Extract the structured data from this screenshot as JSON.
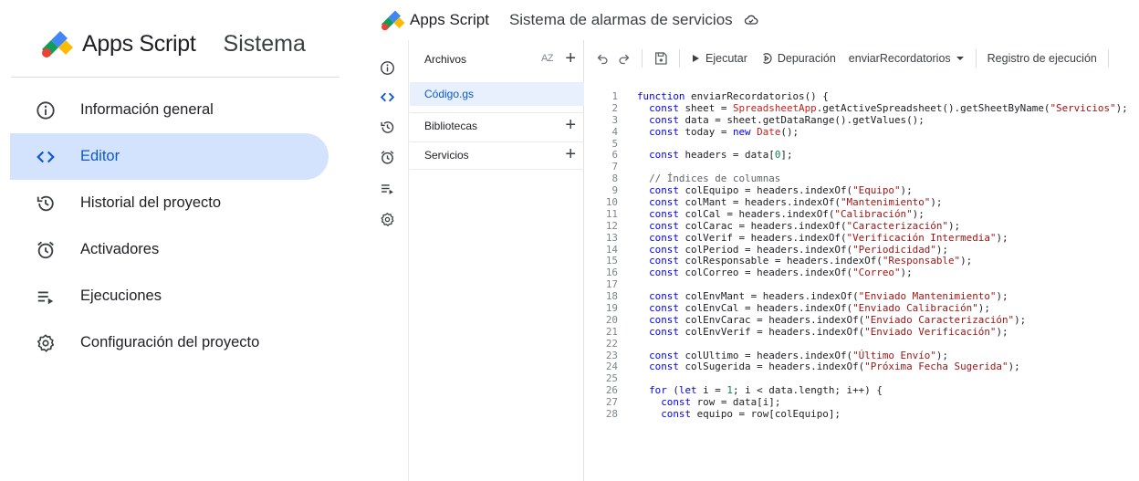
{
  "app": {
    "brand": "Apps Script",
    "project_title": "Sistema de alarmas de servicios",
    "project_title_short": "Sistema"
  },
  "left_nav": {
    "items": [
      {
        "label": "Información general",
        "icon": "info-icon"
      },
      {
        "label": "Editor",
        "icon": "code-icon",
        "active": true
      },
      {
        "label": "Historial del proyecto",
        "icon": "history-icon"
      },
      {
        "label": "Activadores",
        "icon": "alarm-icon"
      },
      {
        "label": "Ejecuciones",
        "icon": "list-run-icon"
      },
      {
        "label": "Configuración del proyecto",
        "icon": "gear-icon"
      }
    ]
  },
  "files_panel": {
    "files_label": "Archivos",
    "sort_label": "AZ",
    "active_file": "Código.gs",
    "libraries_label": "Bibliotecas",
    "services_label": "Servicios"
  },
  "toolbar": {
    "run_label": "Ejecutar",
    "debug_label": "Depuración",
    "function_selected": "enviarRecordatorios",
    "log_label": "Registro de ejecución"
  },
  "colors": {
    "accent": "#0b57d0",
    "active_bg": "#d3e3fd",
    "keyword": "#0000ff",
    "string": "#a31515"
  },
  "code_lines": [
    "function enviarRecordatorios() {",
    "  const sheet = SpreadsheetApp.getActiveSpreadsheet().getSheetByName(\"Servicios\");",
    "  const data = sheet.getDataRange().getValues();",
    "  const today = new Date();",
    "",
    "  const headers = data[0];",
    "",
    "  // Índices de columnas",
    "  const colEquipo = headers.indexOf(\"Equipo\");",
    "  const colMant = headers.indexOf(\"Mantenimiento\");",
    "  const colCal = headers.indexOf(\"Calibración\");",
    "  const colCarac = headers.indexOf(\"Caracterización\");",
    "  const colVerif = headers.indexOf(\"Verificación Intermedia\");",
    "  const colPeriod = headers.indexOf(\"Periodicidad\");",
    "  const colResponsable = headers.indexOf(\"Responsable\");",
    "  const colCorreo = headers.indexOf(\"Correo\");",
    "",
    "  const colEnvMant = headers.indexOf(\"Enviado Mantenimiento\");",
    "  const colEnvCal = headers.indexOf(\"Enviado Calibración\");",
    "  const colEnvCarac = headers.indexOf(\"Enviado Caracterización\");",
    "  const colEnvVerif = headers.indexOf(\"Enviado Verificación\");",
    "",
    "  const colUltimo = headers.indexOf(\"Último Envío\");",
    "  const colSugerida = headers.indexOf(\"Próxima Fecha Sugerida\");",
    "",
    "  for (let i = 1; i < data.length; i++) {",
    "    const row = data[i];",
    "    const equipo = row[colEquipo];"
  ]
}
